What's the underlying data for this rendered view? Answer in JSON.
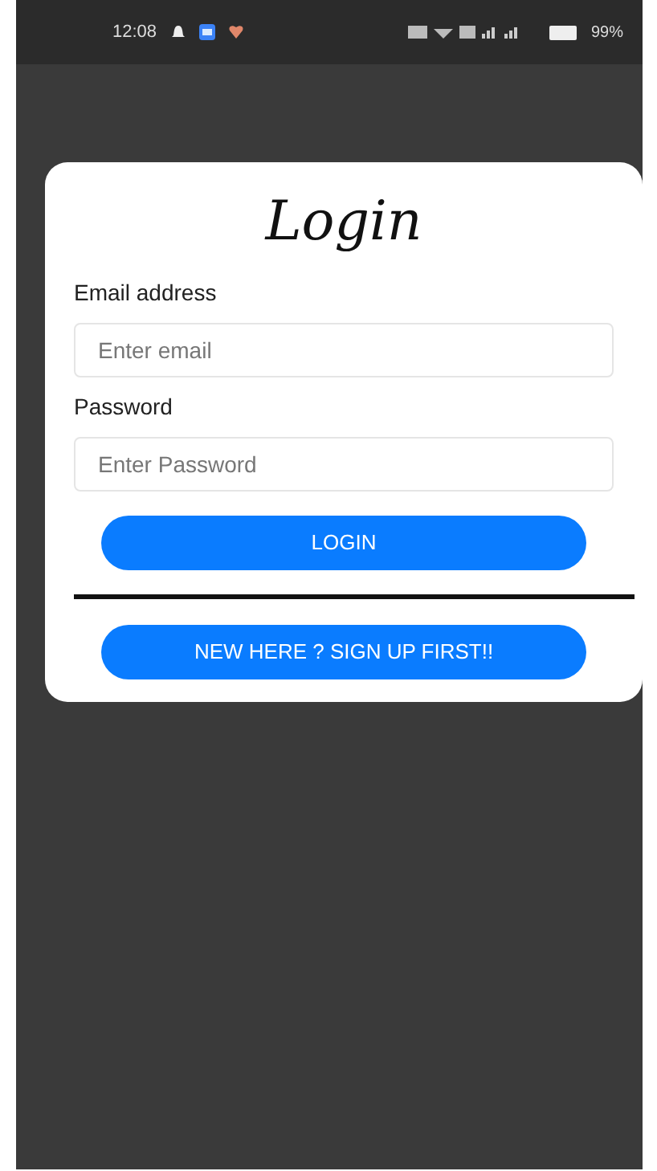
{
  "status_bar": {
    "time": "12:08",
    "battery": "99%"
  },
  "login_card": {
    "title": "Login",
    "fields": [
      {
        "label": "Email address",
        "placeholder": "Enter email"
      },
      {
        "label": "Password",
        "placeholder": "Enter Password"
      }
    ],
    "login_button": "LOGIN",
    "signup_button": "NEW HERE ? SIGN UP FIRST!!"
  }
}
